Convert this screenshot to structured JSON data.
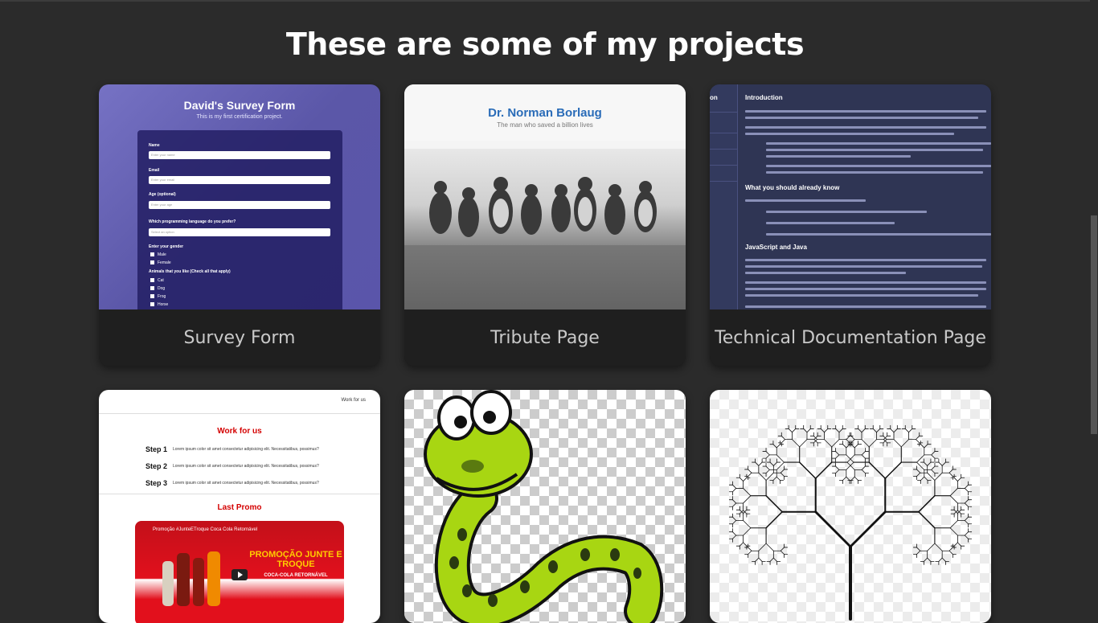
{
  "heading": "These are some of my projects",
  "projects": [
    {
      "caption": "Survey Form",
      "preview": {
        "title": "David's Survey Form",
        "subtitle": "This is my first certification project.",
        "fields": [
          "Name",
          "Email",
          "Age (optional)"
        ],
        "placeholders": [
          "Enter your name",
          "Enter your email",
          "Enter your age"
        ],
        "question1": "Which programming language do you prefer?",
        "select_value": "Select an option",
        "question2": "Enter your gender",
        "genders": [
          "Male",
          "Female"
        ],
        "question3": "Animals that you like (Check all that apply)",
        "animals": [
          "Cat",
          "Dog",
          "Frog",
          "Horse"
        ]
      }
    },
    {
      "caption": "Tribute Page",
      "preview": {
        "title": "Dr. Norman Borlaug",
        "subtitle": "The man who saved a billion lives"
      }
    },
    {
      "caption": "Technical Documentation Page",
      "preview": {
        "nav_fragment": "on",
        "sections": [
          "Introduction",
          "What you should already know",
          "JavaScript and Java"
        ]
      }
    },
    {
      "caption": "",
      "preview": {
        "nav_link": "Work for us",
        "title": "Work for us",
        "steps": [
          "Step 1",
          "Step 2",
          "Step 3"
        ],
        "step_text": "Lorem ipsum color sit amet consectetur adipisicing elit. Necessitatibus, possimus?",
        "promo_title": "Last Promo",
        "video_title": "Promoção #JunteETroque Coca Cola Retornável",
        "video_promo": "PROMOÇÃO JUNTE E TROQUE",
        "video_sub": "COCA-COLA RETORNÁVEL"
      }
    },
    {
      "caption": "",
      "preview": {
        "image": "snake-illustration"
      }
    },
    {
      "caption": "",
      "preview": {
        "image": "fractal-tree"
      }
    }
  ],
  "colors": {
    "background": "#2b2b2b",
    "card": "#1f1f1f",
    "caption_text": "#c9c9c9"
  }
}
